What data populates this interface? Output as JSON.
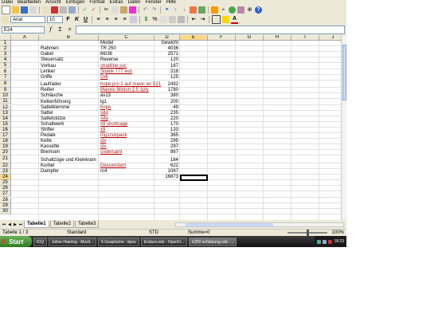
{
  "menu": [
    "Datei",
    "Bearbeiten",
    "Ansicht",
    "Einfügen",
    "Format",
    "Extras",
    "Daten",
    "Fenster",
    "Hilfe"
  ],
  "toolbar": {
    "font_name": "Arial",
    "font_size": "10",
    "colors": {
      "bold": "#000000",
      "font_color": "#cc0000",
      "highlight": "#ffd700"
    }
  },
  "formula_bar": {
    "cell_ref": "E24",
    "content": ""
  },
  "columns": [
    "A",
    "B",
    "C",
    "D",
    "E",
    "F",
    "G",
    "H",
    "I",
    "J"
  ],
  "selected_column": "E",
  "rows": [
    {
      "n": "1",
      "b": "",
      "c": "Model",
      "d": "Gewicht"
    },
    {
      "n": "2",
      "b": "Rahmen",
      "c": "TR 250",
      "d": "4036"
    },
    {
      "n": "3",
      "b": "Gabel",
      "c": "66/36",
      "d": "2571"
    },
    {
      "n": "4",
      "b": "Steuersatz",
      "c": "Reverse",
      "d": "120"
    },
    {
      "n": "5",
      "b": "Vorbau",
      "c": "straitline ssc",
      "d": "167",
      "red": true
    },
    {
      "n": "6",
      "b": "Lenker",
      "c": "Spank 777 evo",
      "d": "318",
      "red": true
    },
    {
      "n": "7",
      "b": "Griffe",
      "c": "Odi",
      "d": "125",
      "red": true
    },
    {
      "n": "8",
      "b": "Laufräder",
      "c": "hope pro 2 auf mavic en 521",
      "d": "2492",
      "red": true,
      "tall": true
    },
    {
      "n": "9",
      "b": "Reifen",
      "c": "Maxxis Minion 2.5 1ply",
      "d": "1780",
      "red": true
    },
    {
      "n": "10",
      "b": "Schläuche",
      "c": "av13",
      "d": "380"
    },
    {
      "n": "11",
      "b": "Kettenführung",
      "c": "lg1",
      "d": "200"
    },
    {
      "n": "12",
      "b": "Sattelklemme",
      "c": "hope",
      "d": "49",
      "red": true
    },
    {
      "n": "13",
      "b": "Sattel",
      "c": "sdg",
      "d": "235",
      "red": true
    },
    {
      "n": "14",
      "b": "Sattelstütze",
      "c": "sdg",
      "d": "220",
      "red": true
    },
    {
      "n": "15",
      "b": "Schaltwerk",
      "c": "x9 shortcage",
      "d": "170",
      "red": true
    },
    {
      "n": "16",
      "b": "Shifter",
      "c": "x9",
      "d": "133",
      "red": true
    },
    {
      "n": "17",
      "b": "Pedale",
      "c": "mg1/sixpack",
      "d": "365",
      "red": true
    },
    {
      "n": "18",
      "b": "Kette",
      "c": "slx",
      "d": "295",
      "red": true
    },
    {
      "n": "19",
      "b": "Kassette",
      "c": "slx",
      "d": "297",
      "red": true
    },
    {
      "n": "20",
      "b": "Bremsen",
      "c": "code/saint",
      "d": "867",
      "red": true
    },
    {
      "n": "21",
      "b": "Schaltzüge und Kleinkram",
      "c": "",
      "d": "164",
      "tall": true
    },
    {
      "n": "22",
      "b": "Kurbel",
      "c": "Descendant",
      "d": "622",
      "red": true
    },
    {
      "n": "23",
      "b": "Dampfer",
      "c": "rc4",
      "d": "1067"
    },
    {
      "n": "24",
      "b": "",
      "c": "",
      "d": "16873",
      "selected": true
    },
    {
      "n": "25",
      "b": "",
      "c": "",
      "d": ""
    },
    {
      "n": "26",
      "b": "",
      "c": "",
      "d": ""
    },
    {
      "n": "27",
      "b": "",
      "c": "",
      "d": ""
    },
    {
      "n": "28",
      "b": "",
      "c": "",
      "d": ""
    },
    {
      "n": "29",
      "b": "",
      "c": "",
      "d": ""
    },
    {
      "n": "30",
      "b": "",
      "c": "",
      "d": ""
    }
  ],
  "sheet_tabs": [
    "Tabelle1",
    "Tabelle2",
    "Tabelle3"
  ],
  "active_tab": "Tabelle1",
  "status": {
    "sheet": "Tabelle 1 / 3",
    "style": "Standard",
    "mode": "STD",
    "sum": "Summe=0",
    "zoom": "100%"
  },
  "taskbar": {
    "start": "Start",
    "tasks": [
      "ICQ",
      "Joline Haering - Mozil...",
      "5 Gespräche - lipeo",
      "Enduro.ods - OpenO...",
      "tr250 schätzung.ods -..."
    ],
    "active_task": 4,
    "clock": "18:23"
  }
}
